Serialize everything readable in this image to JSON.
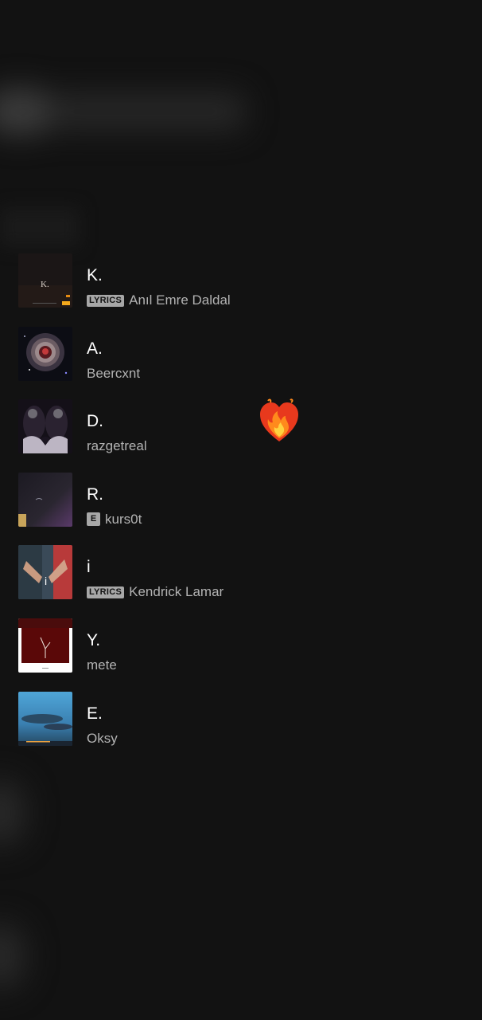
{
  "tracks": [
    {
      "title": "K.",
      "artist": "Anıl Emre Daldal",
      "badge": "LYRICS",
      "cover": "album-k"
    },
    {
      "title": "A.",
      "artist": "Beercxnt",
      "badge": "",
      "cover": "album-a"
    },
    {
      "title": "D.",
      "artist": "razgetreal",
      "badge": "",
      "cover": "album-d"
    },
    {
      "title": "R.",
      "artist": "kurs0t",
      "badge": "E",
      "cover": "album-r"
    },
    {
      "title": "i",
      "artist": "Kendrick Lamar",
      "badge": "LYRICS",
      "cover": "album-i"
    },
    {
      "title": "Y.",
      "artist": "mete",
      "badge": "",
      "cover": "album-y"
    },
    {
      "title": "E.",
      "artist": "Oksy",
      "badge": "",
      "cover": "album-e"
    }
  ],
  "cover_text": {
    "k": "K."
  },
  "sticker": {
    "icon": "fire-heart-icon",
    "colors": [
      "#e8391d",
      "#ff8a1c",
      "#ffd23f"
    ]
  }
}
